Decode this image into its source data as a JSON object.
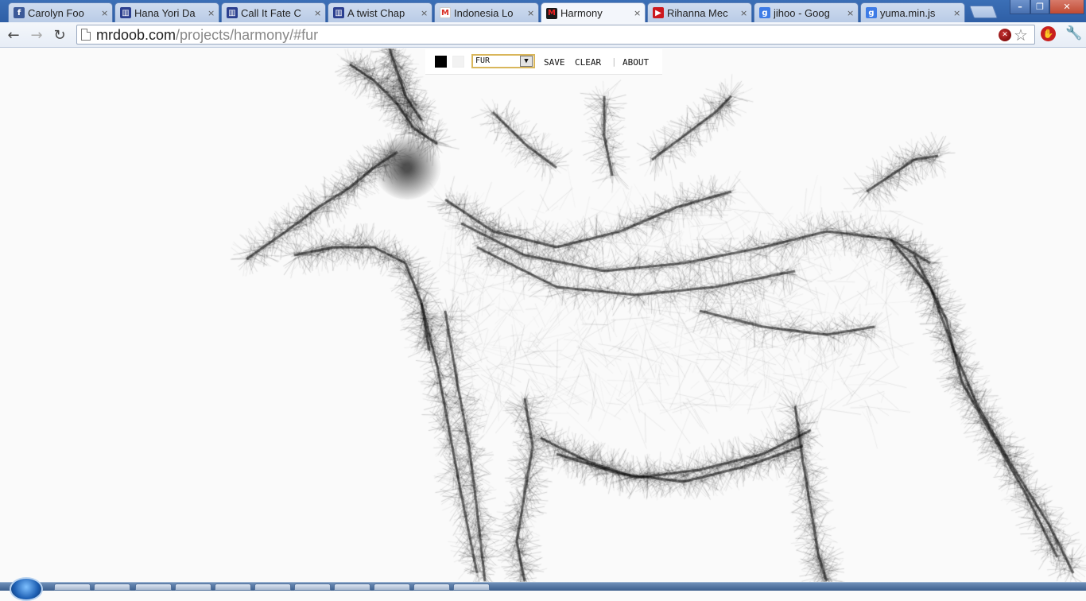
{
  "browser": {
    "tabs": [
      {
        "title": "Carolyn Foo",
        "icon": "facebook-icon",
        "color": "#3b5998",
        "glyph": "f",
        "active": false
      },
      {
        "title": "Hana Yori Da",
        "icon": "fanfiction-icon",
        "color": "#2b3f8f",
        "glyph": "▥",
        "active": false
      },
      {
        "title": "Call It Fate C",
        "icon": "fanfiction-icon",
        "color": "#2b3f8f",
        "glyph": "▥",
        "active": false
      },
      {
        "title": "A twist Chap",
        "icon": "fanfiction-icon",
        "color": "#2b3f8f",
        "glyph": "▥",
        "active": false
      },
      {
        "title": "Indonesia Lo",
        "icon": "gmail-icon",
        "color": "#ffffff",
        "glyph": "M",
        "active": false
      },
      {
        "title": "Harmony",
        "icon": "mrdoob-icon",
        "color": "#1a1a1a",
        "glyph": "M",
        "active": true
      },
      {
        "title": "Rihanna Mec",
        "icon": "youtube-icon",
        "color": "#cc181e",
        "glyph": "▶",
        "active": false
      },
      {
        "title": "jihoo - Goog",
        "icon": "google-icon",
        "color": "#3d7be6",
        "glyph": "g",
        "active": false
      },
      {
        "title": "yuma.min.js",
        "icon": "google-icon",
        "color": "#3d7be6",
        "glyph": "g",
        "active": false
      }
    ],
    "url_host": "mrdoob.com",
    "url_path": "/projects/harmony/#fur"
  },
  "harmony": {
    "brush": "FUR",
    "save_label": "SAVE",
    "clear_label": "CLEAR",
    "separator": "|",
    "about_label": "ABOUT",
    "foreground_color": "#000000",
    "background_color": "#f2f2f2"
  }
}
